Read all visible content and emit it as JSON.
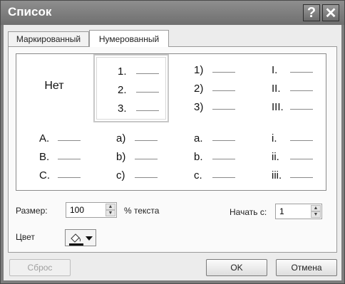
{
  "window": {
    "title": "Список"
  },
  "titlebar": {
    "help_label": "?",
    "close_label": "✕"
  },
  "tabs": [
    {
      "label": "Маркированный",
      "active": false
    },
    {
      "label": "Нумерованный",
      "active": true
    }
  ],
  "gallery": {
    "none_label": "Нет",
    "cells": [
      {
        "kind": "none"
      },
      {
        "kind": "list",
        "items": [
          "1.",
          "2.",
          "3."
        ],
        "selected": true
      },
      {
        "kind": "list",
        "items": [
          "1)",
          "2)",
          "3)"
        ]
      },
      {
        "kind": "list",
        "items": [
          "I.",
          "II.",
          "III."
        ]
      },
      {
        "kind": "list",
        "items": [
          "A.",
          "B.",
          "C."
        ]
      },
      {
        "kind": "list",
        "items": [
          "a)",
          "b)",
          "c)"
        ]
      },
      {
        "kind": "list",
        "items": [
          "a.",
          "b.",
          "c."
        ]
      },
      {
        "kind": "list",
        "items": [
          "i.",
          "ii.",
          "iii."
        ]
      }
    ]
  },
  "options": {
    "size_label": "Размер:",
    "size_value": "100",
    "size_suffix": "% текста",
    "start_label": "Начать с:",
    "start_value": "1",
    "color_label": "Цвет"
  },
  "buttons": {
    "reset": "Сброс",
    "ok": "OK",
    "cancel": "Отмена"
  }
}
